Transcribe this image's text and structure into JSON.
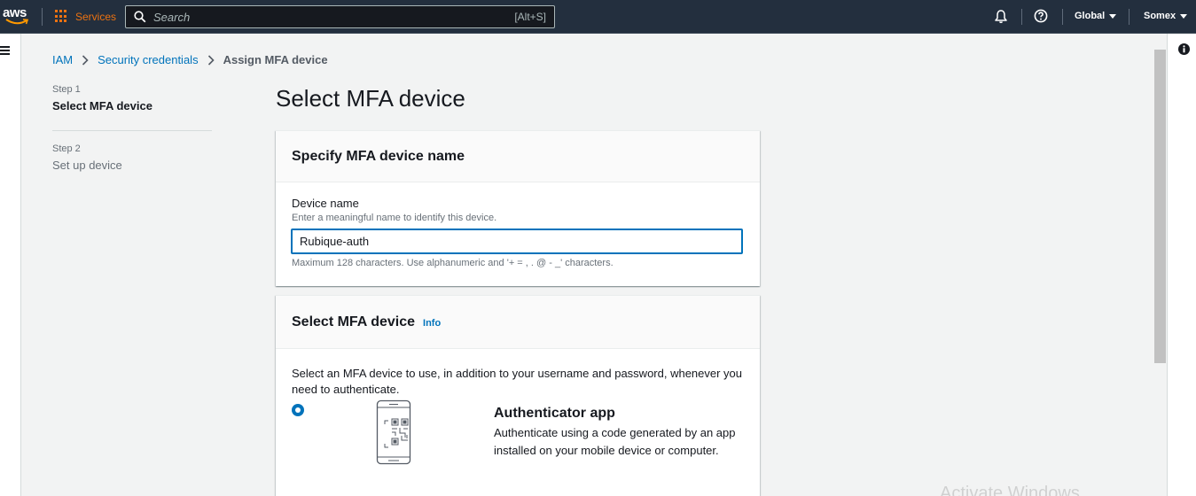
{
  "topnav": {
    "logo_text": "aws",
    "services_label": "Services",
    "search_placeholder": "Search",
    "search_shortcut": "[Alt+S]",
    "region_label": "Global",
    "account_label": "Somex",
    "icons": [
      "bell-icon",
      "help-icon"
    ]
  },
  "breadcrumb": {
    "items": [
      "IAM",
      "Security credentials"
    ],
    "current": "Assign MFA device"
  },
  "steps": [
    {
      "number": "Step 1",
      "title": "Select MFA device",
      "active": true
    },
    {
      "number": "Step 2",
      "title": "Set up device",
      "active": false
    }
  ],
  "page_title": "Select MFA device",
  "device_name_panel": {
    "title": "Specify MFA device name",
    "field_label": "Device name",
    "field_description": "Enter a meaningful name to identify this device.",
    "field_value": "Rubique-auth",
    "field_hint": "Maximum 128 characters. Use alphanumeric and '+ = , . @ - _' characters."
  },
  "mfa_device_panel": {
    "title": "Select MFA device",
    "info_label": "Info",
    "description": "Select an MFA device to use, in addition to your username and password, whenever you need to authenticate.",
    "options": [
      {
        "title": "Authenticator app",
        "description": "Authenticate using a code generated by an app installed on your mobile device or computer.",
        "selected": true,
        "icon": "phone-qr-icon"
      }
    ]
  },
  "watermark": "Activate Windows",
  "colors": {
    "nav_bg": "#232f3e",
    "accent_orange": "#ec7211",
    "link_blue": "#0073bb",
    "page_bg": "#f2f3f3"
  }
}
